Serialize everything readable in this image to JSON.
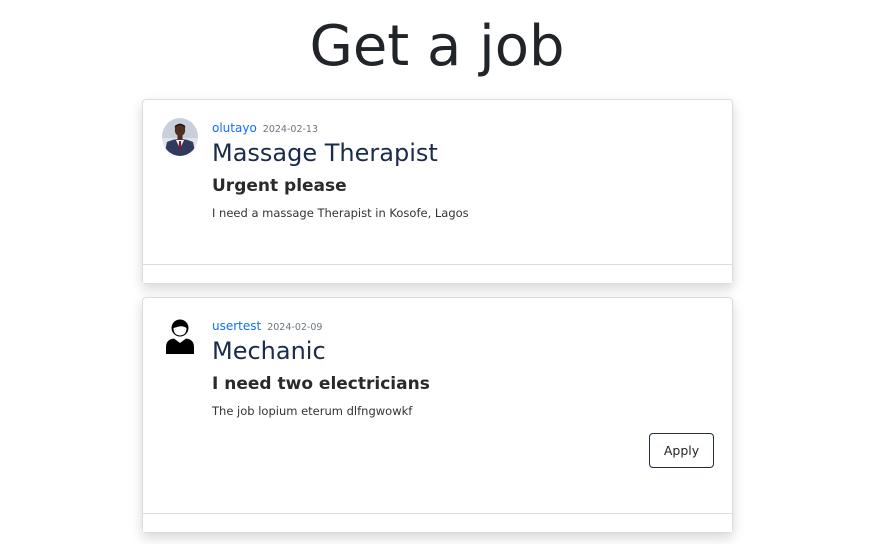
{
  "page": {
    "title": "Get a job"
  },
  "posts": [
    {
      "username": "olutayo",
      "date": "2024-02-13",
      "job_title": "Massage Therapist",
      "subtitle": "Urgent please",
      "description": "I need a massage Therapist in Kosofe, Lagos",
      "avatar_icon": "user-photo-icon"
    },
    {
      "username": "usertest",
      "date": "2024-02-09",
      "job_title": "Mechanic",
      "subtitle": "I need two electricians",
      "description": "The job lopium eterum dlfngwowkf",
      "avatar_icon": "default-user-icon",
      "apply_label": "Apply"
    }
  ],
  "colors": {
    "link": "#0d6efd",
    "title": "#1a2b4c",
    "button_border": "#212d44"
  }
}
